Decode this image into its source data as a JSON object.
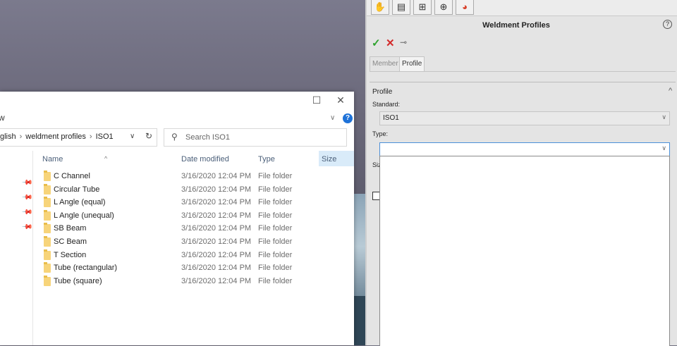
{
  "explorer": {
    "window_controls": {
      "maximize": "☐",
      "close": "✕"
    },
    "ribbon_label": "w",
    "breadcrumb": [
      "glish",
      "weldment profiles",
      "ISO1"
    ],
    "search_placeholder": "Search ISO1",
    "columns": {
      "name": "Name",
      "date": "Date modified",
      "type": "Type",
      "size": "Size"
    },
    "files": [
      {
        "name": "C Channel",
        "date": "3/16/2020 12:04 PM",
        "type": "File folder"
      },
      {
        "name": "Circular Tube",
        "date": "3/16/2020 12:04 PM",
        "type": "File folder"
      },
      {
        "name": "L Angle (equal)",
        "date": "3/16/2020 12:04 PM",
        "type": "File folder"
      },
      {
        "name": "L Angle (unequal)",
        "date": "3/16/2020 12:04 PM",
        "type": "File folder"
      },
      {
        "name": "SB Beam",
        "date": "3/16/2020 12:04 PM",
        "type": "File folder"
      },
      {
        "name": "SC Beam",
        "date": "3/16/2020 12:04 PM",
        "type": "File folder"
      },
      {
        "name": "T Section",
        "date": "3/16/2020 12:04 PM",
        "type": "File folder"
      },
      {
        "name": "Tube (rectangular)",
        "date": "3/16/2020 12:04 PM",
        "type": "File folder"
      },
      {
        "name": "Tube (square)",
        "date": "3/16/2020 12:04 PM",
        "type": "File folder"
      }
    ]
  },
  "propertymanager": {
    "title": "Weldment Profiles",
    "help": "?",
    "tabs": {
      "member": "Member",
      "profile": "Profile"
    },
    "group_title": "Profile",
    "standard_label": "Standard:",
    "standard_value": "ISO1",
    "type_label": "Type:",
    "type_value": "",
    "size_label_partial": "Siz"
  }
}
